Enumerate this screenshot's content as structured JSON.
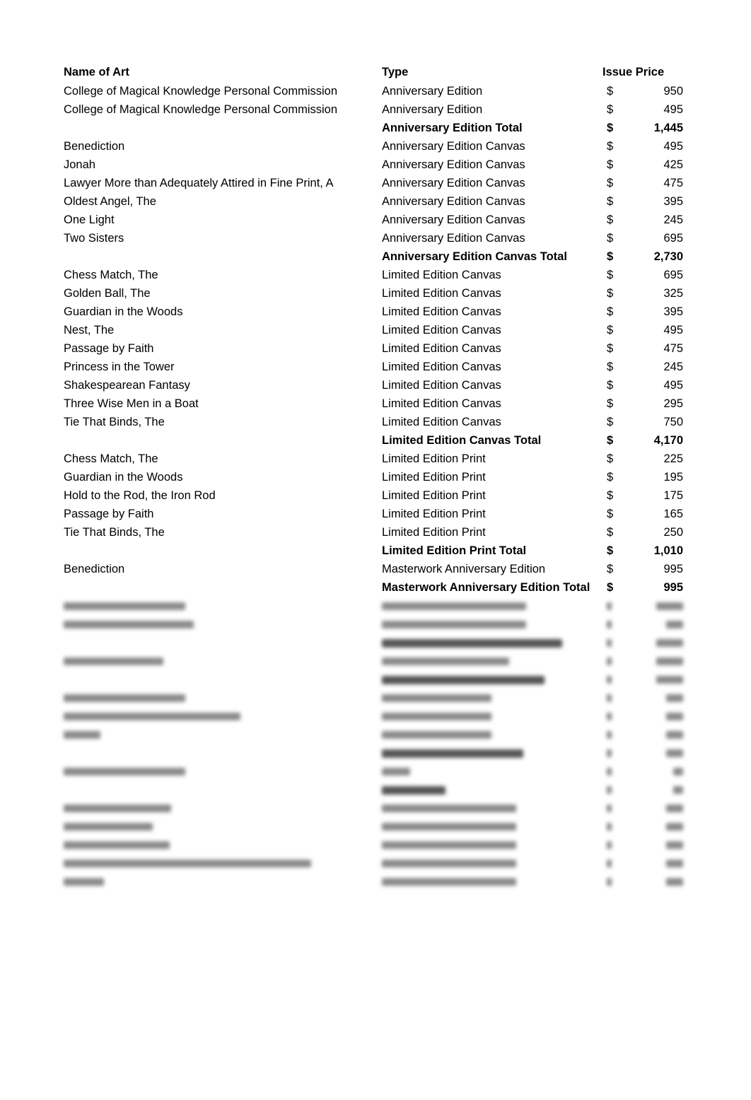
{
  "header": {
    "name": "Name of Art",
    "type": "Type",
    "price": "Issue Price"
  },
  "currency_symbol": "$",
  "rows": [
    {
      "name": "College of Magical Knowledge Personal Commission",
      "type": "Anniversary Edition",
      "price": "950"
    },
    {
      "name": "College of Magical Knowledge Personal Commission",
      "type": "Anniversary Edition",
      "price": "495"
    },
    {
      "name": "",
      "type": "Anniversary Edition Total",
      "price": "1,445",
      "total": true
    },
    {
      "name": "Benediction",
      "type": "Anniversary Edition Canvas",
      "price": "495"
    },
    {
      "name": "Jonah",
      "type": "Anniversary Edition Canvas",
      "price": "425"
    },
    {
      "name": "Lawyer More than Adequately Attired in Fine Print, A",
      "type": "Anniversary Edition Canvas",
      "price": "475"
    },
    {
      "name": "Oldest Angel, The",
      "type": "Anniversary Edition Canvas",
      "price": "395"
    },
    {
      "name": "One Light",
      "type": "Anniversary Edition Canvas",
      "price": "245"
    },
    {
      "name": "Two Sisters",
      "type": "Anniversary Edition Canvas",
      "price": "695"
    },
    {
      "name": "",
      "type": "Anniversary Edition Canvas Total",
      "price": "2,730",
      "total": true
    },
    {
      "name": "Chess Match, The",
      "type": "Limited Edition Canvas",
      "price": "695"
    },
    {
      "name": "Golden Ball, The",
      "type": "Limited Edition Canvas",
      "price": "325"
    },
    {
      "name": "Guardian in the Woods",
      "type": "Limited Edition Canvas",
      "price": "395"
    },
    {
      "name": "Nest, The",
      "type": "Limited Edition Canvas",
      "price": "495"
    },
    {
      "name": "Passage by Faith",
      "type": "Limited Edition Canvas",
      "price": "475"
    },
    {
      "name": "Princess in the Tower",
      "type": "Limited Edition Canvas",
      "price": "245"
    },
    {
      "name": "Shakespearean Fantasy",
      "type": "Limited Edition Canvas",
      "price": "495"
    },
    {
      "name": "Three Wise Men in a Boat",
      "type": "Limited Edition Canvas",
      "price": "295"
    },
    {
      "name": "Tie That Binds, The",
      "type": "Limited Edition Canvas",
      "price": "750"
    },
    {
      "name": "",
      "type": "Limited Edition Canvas Total",
      "price": "4,170",
      "total": true
    },
    {
      "name": "Chess Match, The",
      "type": "Limited Edition Print",
      "price": "225"
    },
    {
      "name": "Guardian in the Woods",
      "type": "Limited Edition Print",
      "price": "195"
    },
    {
      "name": "Hold to the Rod, the Iron Rod",
      "type": "Limited Edition Print",
      "price": "175"
    },
    {
      "name": "Passage by Faith",
      "type": "Limited Edition Print",
      "price": "165"
    },
    {
      "name": "Tie That Binds, The",
      "type": "Limited Edition Print",
      "price": "250"
    },
    {
      "name": "",
      "type": "Limited Edition Print Total",
      "price": "1,010",
      "total": true
    },
    {
      "name": "Benediction",
      "type": "Masterwork Anniversary Edition",
      "price": "995"
    },
    {
      "name": "",
      "type": "Masterwork Anniversary Edition Total",
      "price": "995",
      "total": true
    }
  ]
}
